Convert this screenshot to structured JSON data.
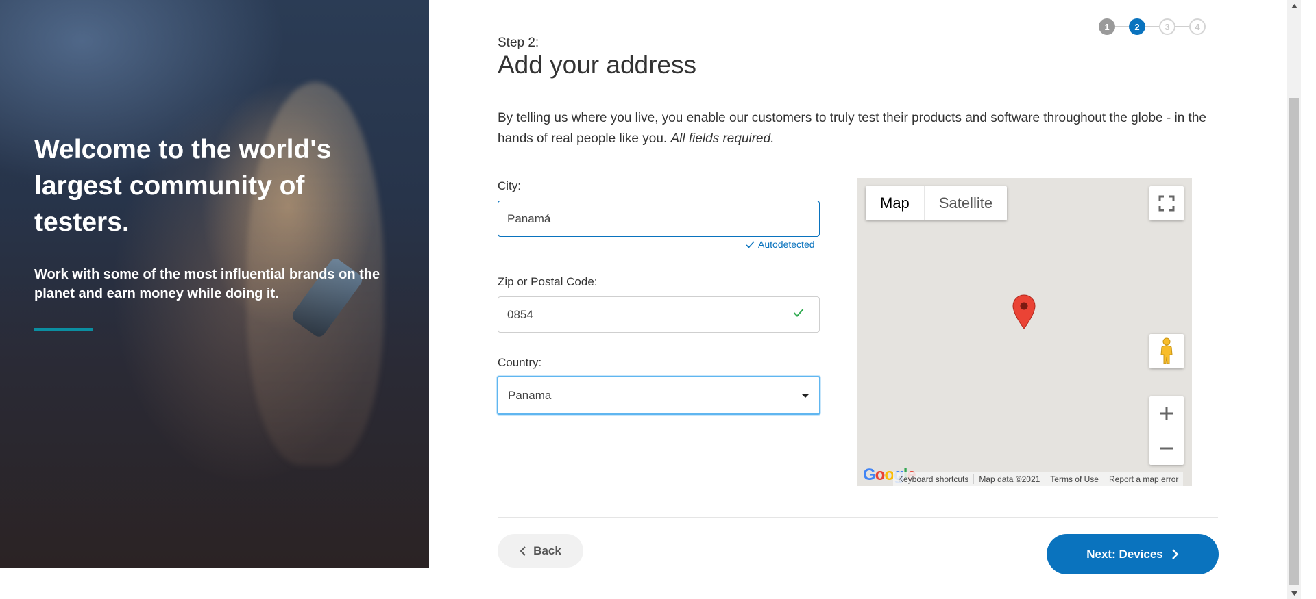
{
  "hero": {
    "title": "Welcome to the world's largest community of testers.",
    "subtitle": "Work with some of the most influential brands on the planet and earn money while doing it."
  },
  "stepper": {
    "steps": [
      "1",
      "2",
      "3",
      "4"
    ],
    "current": 2
  },
  "form": {
    "step_label": "Step 2:",
    "title": "Add your address",
    "intro": "By telling us where you live, you enable our customers to truly test their products and software throughout the globe - in the hands of real people like you.",
    "intro_required": "All fields required.",
    "city_label": "City:",
    "city_value": "Panamá",
    "autodetected": "Autodetected",
    "zip_label": "Zip or Postal Code:",
    "zip_value": "0854",
    "country_label": "Country:",
    "country_value": "Panama"
  },
  "map": {
    "type_map": "Map",
    "type_satellite": "Satellite",
    "logo": "Google",
    "footer": {
      "shortcuts": "Keyboard shortcuts",
      "data": "Map data ©2021",
      "terms": "Terms of Use",
      "report": "Report a map error"
    }
  },
  "nav": {
    "back": "Back",
    "next": "Next: Devices"
  },
  "colors": {
    "primary": "#0a73be",
    "accent_line": "#0b8ea1",
    "success": "#2eaa4f",
    "pin": "#ea4335"
  }
}
